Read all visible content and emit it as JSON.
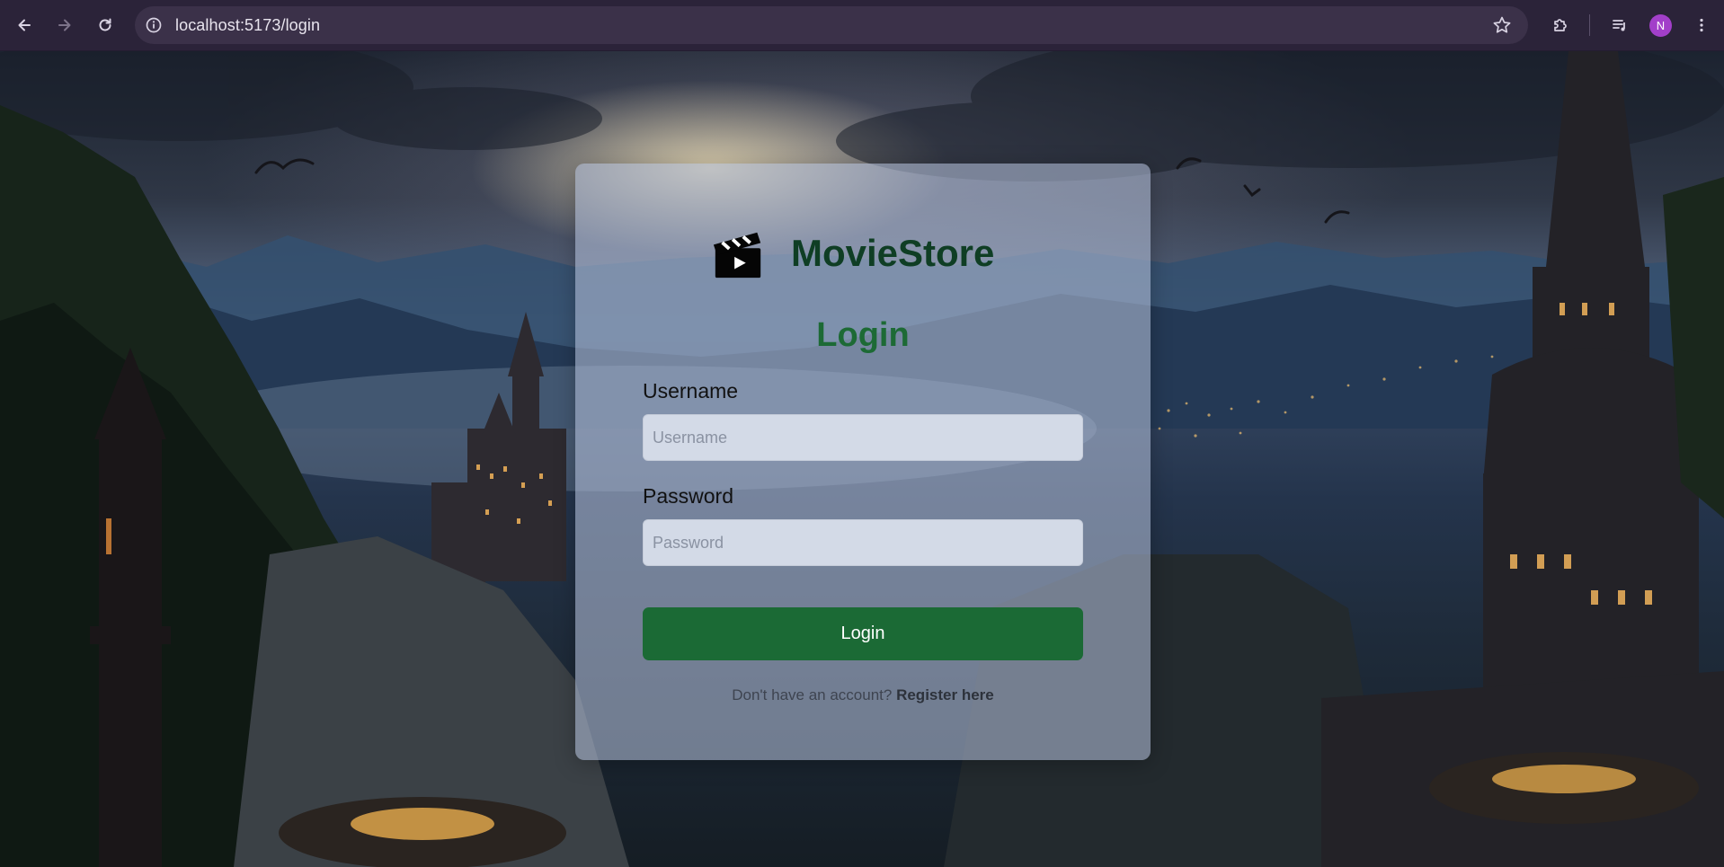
{
  "browser": {
    "url": "localhost:5173/login",
    "profile_initial": "N",
    "profile_color": "#a23fc9"
  },
  "card": {
    "brand_name": "MovieStore",
    "brand_icon": "clapperboard-icon",
    "heading": "Login",
    "username_label": "Username",
    "username_placeholder": "Username",
    "username_value": "",
    "password_label": "Password",
    "password_placeholder": "Password",
    "password_value": "",
    "login_button": "Login",
    "register_prompt": "Don't have an account?",
    "register_link": "Register here"
  },
  "colors": {
    "brand": "#0f3e24",
    "accent": "#1b6a35",
    "heading": "#1d6a35"
  }
}
